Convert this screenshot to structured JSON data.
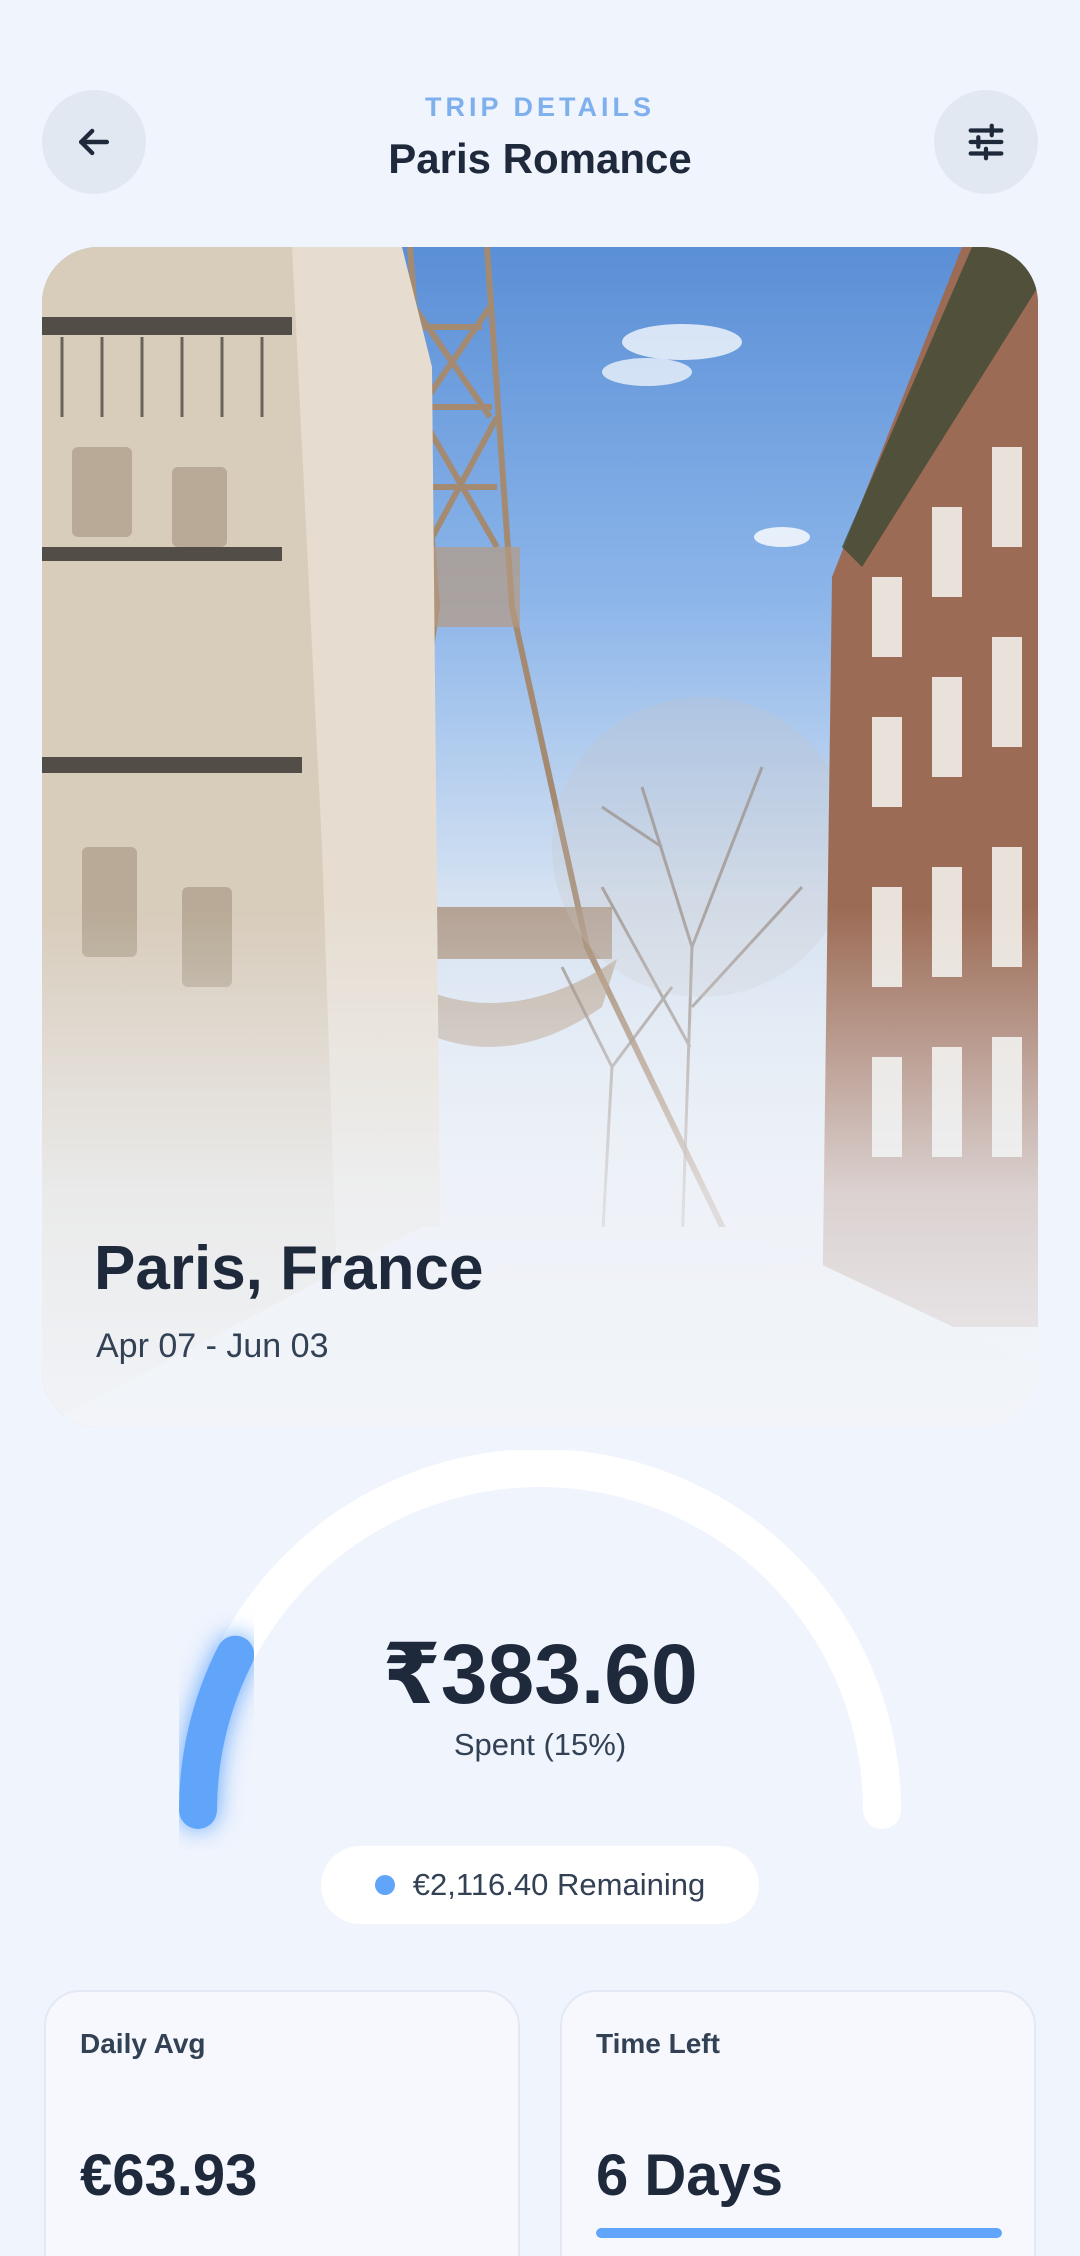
{
  "header": {
    "eyebrow": "TRIP DETAILS",
    "title": "Paris Romance",
    "back_icon": "arrow-left-icon",
    "filter_icon": "sliders-icon"
  },
  "hero": {
    "city": "Paris, France",
    "dates": "Apr 07 - Jun 03"
  },
  "budget": {
    "amount": "₹383.60",
    "spent_label": "Spent (15%)",
    "spent_fraction": 0.15,
    "remaining_label": "€2,116.40 Remaining"
  },
  "stats": {
    "daily_avg_label": "Daily Avg",
    "daily_avg_value": "€63.93",
    "time_left_label": "Time Left",
    "time_left_value": "6 Days",
    "time_left_progress": 1.0
  },
  "colors": {
    "accent": "#60a5fa",
    "background": "#f0f4fd",
    "text": "#1e293b",
    "eyebrow": "#7fb0ee"
  }
}
